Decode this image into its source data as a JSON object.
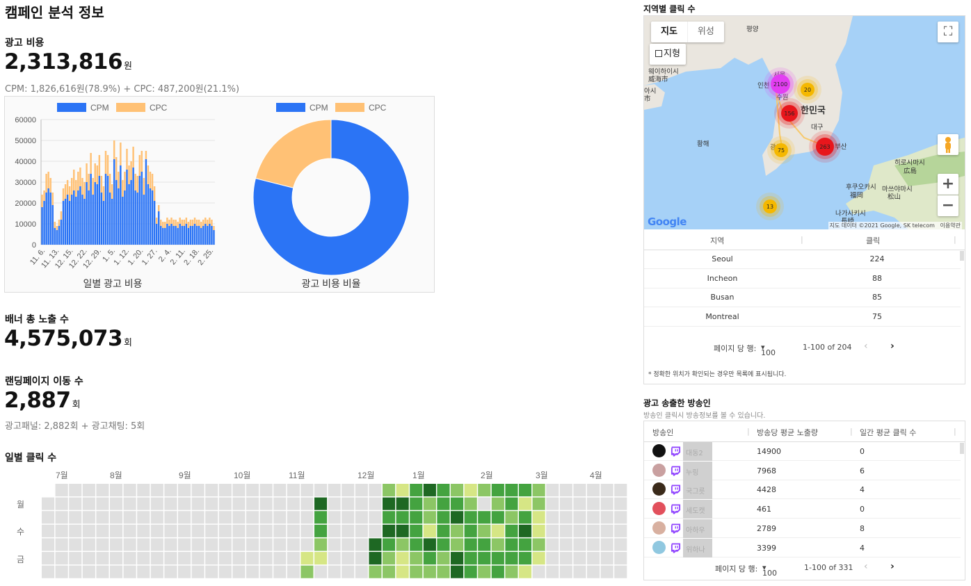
{
  "page_title": "캠페인 분석 정보",
  "ad_cost": {
    "title": "광고 비용",
    "value": "2,313,816",
    "unit": "원",
    "breakdown": "CPM: 1,826,616원(78.9%) + CPC: 487,200원(21.1%)"
  },
  "banner": {
    "title": "배너 총 노출 수",
    "value": "4,575,073",
    "unit": "회"
  },
  "landing": {
    "title": "랜딩페이지 이동 수",
    "value": "2,887",
    "unit": "회",
    "breakdown": "광고패널: 2,882회 + 광고채팅: 5회"
  },
  "daily_clicks_title": "일별 클릭 수",
  "chart_data": [
    {
      "type": "bar",
      "stacked": true,
      "title": "일별 광고 비용",
      "ylim": [
        0,
        60000
      ],
      "yticks": [
        0,
        10000,
        20000,
        30000,
        40000,
        50000,
        60000
      ],
      "x_tick_labels": [
        "11. 6.",
        "11. 13.",
        "12. 15.",
        "12. 22.",
        "12. 29.",
        "1. 5.",
        "1. 12.",
        "1. 20.",
        "1. 27.",
        "2. 4.",
        "2. 11.",
        "2. 18.",
        "2. 25."
      ],
      "legend": [
        "CPM",
        "CPC"
      ],
      "colors": {
        "CPM": "#2b74f5",
        "CPC": "#ffc175"
      },
      "series": [
        {
          "name": "CPM",
          "values": [
            18000,
            21000,
            25000,
            27000,
            25000,
            19000,
            8000,
            7000,
            9000,
            12000,
            21000,
            22000,
            24000,
            21000,
            24000,
            26000,
            23000,
            26000,
            28000,
            24000,
            22000,
            30000,
            26000,
            34000,
            24000,
            30000,
            29000,
            33000,
            25000,
            21000,
            34000,
            33000,
            25000,
            22000,
            41000,
            31000,
            27000,
            38000,
            23000,
            26000,
            36000,
            29000,
            31000,
            37000,
            26000,
            25000,
            33000,
            35000,
            24000,
            41000,
            29000,
            27000,
            26000,
            21000,
            10000,
            16000,
            9000,
            8000,
            8000,
            10000,
            9000,
            10000,
            9000,
            9000,
            8000,
            10000,
            9000,
            9000,
            10000,
            8000,
            9000,
            9000,
            10000,
            9000,
            9000,
            8000,
            9000,
            10000,
            9000,
            10000,
            9000,
            7000
          ]
        },
        {
          "name": "CPC",
          "values": [
            6000,
            5000,
            9000,
            8000,
            7000,
            6000,
            3000,
            2000,
            3000,
            4000,
            6000,
            7000,
            7000,
            7000,
            8000,
            10000,
            8000,
            9000,
            9000,
            8000,
            8000,
            9000,
            8000,
            10000,
            8000,
            9000,
            9000,
            10000,
            8000,
            7000,
            11000,
            10000,
            9000,
            7000,
            9000,
            11000,
            8000,
            11000,
            8000,
            9000,
            10000,
            9000,
            9000,
            10000,
            8000,
            8000,
            10000,
            10000,
            8000,
            4000,
            9000,
            8000,
            8000,
            7000,
            3000,
            3000,
            3000,
            3000,
            3000,
            3000,
            3000,
            3000,
            3000,
            3000,
            3000,
            3000,
            3000,
            3000,
            3000,
            3000,
            3000,
            3000,
            3000,
            3000,
            3000,
            3000,
            3000,
            3000,
            3000,
            3000,
            3000,
            2000
          ]
        }
      ]
    },
    {
      "type": "pie",
      "donut": true,
      "title": "광고 비용 비율",
      "legend": [
        "CPM",
        "CPC"
      ],
      "categories": [
        "CPM",
        "CPC"
      ],
      "values": [
        1826616,
        487200
      ],
      "colors": [
        "#2b74f5",
        "#ffc175"
      ]
    },
    {
      "type": "heatmap",
      "title": "일별 클릭 수",
      "month_labels": [
        "7월",
        "8월",
        "9월",
        "10월",
        "11월",
        "12월",
        "1월",
        "2월",
        "3월",
        "4월"
      ],
      "day_labels": [
        "월",
        "수",
        "금"
      ],
      "weeks": 43,
      "levels": [
        "#e0e0e0",
        "#d6e685",
        "#8cc665",
        "#44a340",
        "#1e6823"
      ],
      "week_levels": {
        "20": [
          0,
          4,
          3,
          3,
          2,
          1,
          0
        ],
        "19": [
          0,
          0,
          0,
          0,
          0,
          1,
          2
        ],
        "24": [
          0,
          0,
          0,
          0,
          4,
          4,
          2
        ],
        "25": [
          2,
          4,
          3,
          4,
          3,
          2,
          2
        ],
        "26": [
          1,
          4,
          3,
          4,
          2,
          1,
          1
        ],
        "27": [
          3,
          3,
          3,
          3,
          3,
          2,
          2
        ],
        "28": [
          4,
          2,
          2,
          1,
          4,
          3,
          2
        ],
        "29": [
          3,
          3,
          3,
          3,
          3,
          2,
          2
        ],
        "30": [
          2,
          3,
          4,
          2,
          2,
          4,
          4
        ],
        "31": [
          1,
          2,
          3,
          3,
          3,
          3,
          3
        ],
        "32": [
          2,
          0,
          3,
          2,
          3,
          3,
          2
        ],
        "33": [
          3,
          2,
          3,
          1,
          2,
          3,
          3
        ],
        "34": [
          3,
          3,
          2,
          3,
          3,
          3,
          2
        ],
        "35": [
          3,
          1,
          3,
          4,
          3,
          3,
          1
        ],
        "36": [
          2,
          2,
          1,
          1,
          2,
          1,
          0
        ]
      }
    }
  ],
  "region": {
    "title": "지역별 클릭 수",
    "map_type_buttons": [
      "지도",
      "위성"
    ],
    "terrain_label": "지형",
    "map_labels": [
      "평양",
      "웨이하이시",
      "威海市",
      "인천",
      "서울",
      "수원",
      "한민국",
      "대구",
      "광주",
      "부산",
      "황해",
      "히로시마시",
      "広島",
      "후쿠오카시",
      "福岡",
      "마쓰야마시",
      "松山",
      "나가사키시",
      "長崎",
      "아시",
      "市"
    ],
    "clusters": [
      {
        "count": "2100",
        "color": "#e33ef2"
      },
      {
        "count": "20",
        "color": "#f5b800"
      },
      {
        "count": "156",
        "color": "#e8161c"
      },
      {
        "count": "75",
        "color": "#f5b800"
      },
      {
        "count": "263",
        "color": "#e8161c"
      },
      {
        "count": "13",
        "color": "#f5b800"
      }
    ],
    "map_credit": "지도 데이터 ©2021 Google, SK telecom",
    "map_terms": "이용약관",
    "google_logo": "Google",
    "columns": [
      "지역",
      "클릭"
    ],
    "rows": [
      {
        "region": "Seoul",
        "clicks": "224"
      },
      {
        "region": "Incheon",
        "clicks": "88"
      },
      {
        "region": "Busan",
        "clicks": "85"
      },
      {
        "region": "Montreal",
        "clicks": "75"
      }
    ],
    "pager": {
      "rows_label": "페이지 당 행:",
      "rows_value": "100",
      "range": "1-100 of 204"
    },
    "note": "* 정확한 위치가 확인되는 경우만 목록에 표시됩니다."
  },
  "broadcasters": {
    "title": "광고 송출한 방송인",
    "subtitle": "방송인 클릭시 방송정보를 볼 수 있습니다.",
    "columns": [
      "방송인",
      "방송당 평균 노출량",
      "일간 평균 클릭 수"
    ],
    "rows": [
      {
        "name": "대동2",
        "impressions": "14900",
        "clicks": "0",
        "avatar_color": "#111111"
      },
      {
        "name": "누링",
        "impressions": "7968",
        "clicks": "6",
        "avatar_color": "#c9a0a0"
      },
      {
        "name": "국그릇",
        "impressions": "4428",
        "clicks": "4",
        "avatar_color": "#3a2a1a"
      },
      {
        "name": "세도캣",
        "impressions": "461",
        "clicks": "0",
        "avatar_color": "#e2505c"
      },
      {
        "name": "아하우",
        "impressions": "2789",
        "clicks": "8",
        "avatar_color": "#d8b0a0"
      },
      {
        "name": "위하나",
        "impressions": "3399",
        "clicks": "4",
        "avatar_color": "#90c8e0"
      }
    ],
    "pager": {
      "rows_label": "페이지 당 행:",
      "rows_value": "100",
      "range": "1-100 of 331"
    }
  }
}
